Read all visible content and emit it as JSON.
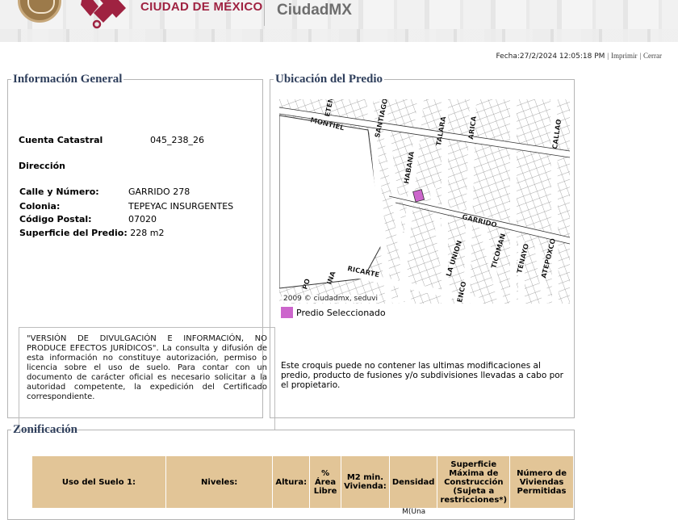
{
  "header": {
    "gov_title": "CIUDAD DE MÉXICO",
    "brand": "CiudadMX"
  },
  "dateline": {
    "fecha": "Fecha:27/2/2024 12:05:18 PM",
    "sep": "|",
    "imprimir": "Imprimir",
    "cerrar": "Cerrar"
  },
  "info": {
    "legend": "Información General",
    "cuenta_label": "Cuenta Catastral",
    "cuenta_value": "045_238_26",
    "direccion_label": "Dirección",
    "rows": [
      {
        "label": "Calle y Número:",
        "value": "GARRIDO 278"
      },
      {
        "label": "Colonia:",
        "value": "TEPEYAC INSURGENTES"
      },
      {
        "label": "Código Postal:",
        "value": "07020"
      },
      {
        "label": "Superficie del Predio:",
        "value": "228 m2"
      }
    ],
    "disclaimer": "\"VERSIÓN DE DIVULGACIÓN E INFORMACIÓN, NO PRODUCE EFECTOS JURÍDICOS\". La consulta y difusión de esta información no constituye autorización, permiso o licencia sobre el uso de suelo. Para contar con un documento de carácter oficial es necesario solicitar a la autoridad competente, la expedición del Certificado correspondiente."
  },
  "ubicacion": {
    "legend": "Ubicación del Predio",
    "credit": "2009 © ciudadmx, seduvi",
    "predio_label": "Predio Seleccionado",
    "predio_color": "#cc66cc",
    "streets": [
      "MONTIEL",
      "ETEN",
      "SANTIAGO",
      "TALARA",
      "ARICA",
      "CALLAO",
      "HABANA",
      "GARRIDO",
      "RICARTE",
      "LA UNION",
      "TICOMAN",
      "TENAYO",
      "ATEPOXCO",
      "INA",
      "PO",
      "ENCO"
    ],
    "croquis": "Este croquis puede no contener las ultimas modificaciones al predio, producto de fusiones y/o subdivisiones llevadas a cabo por el propietario."
  },
  "zonificacion": {
    "legend": "Zonificación",
    "headers": [
      "Uso del Suelo 1:",
      "Niveles:",
      "Altura:",
      "% Área Libre",
      "M2 min. Vivienda:",
      "Densidad",
      "Superficie Máxima de Construcción (Sujeta a restricciones*)",
      "Número de Viviendas Permitidas"
    ],
    "first_row": [
      "",
      "",
      "",
      "",
      "",
      "M(Una",
      "",
      ""
    ]
  },
  "colors": {
    "accent": "#9f2241",
    "legend_text": "#2f3f5c",
    "table_header": "#e2c597"
  }
}
